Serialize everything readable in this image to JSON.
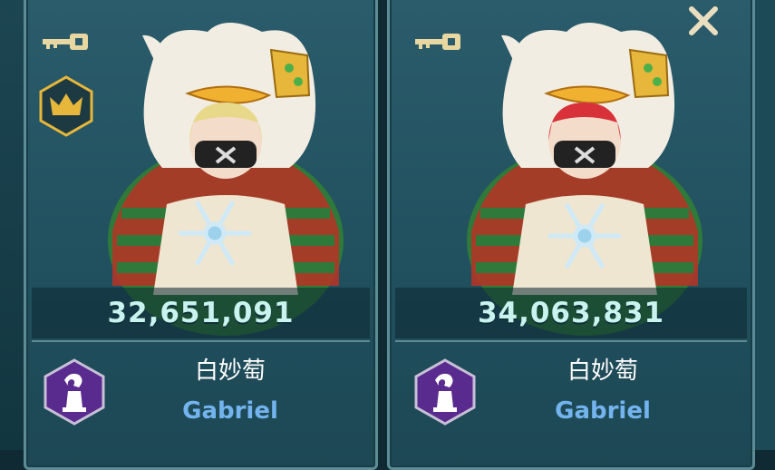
{
  "cards": [
    {
      "score": "32,651,091",
      "name_cn": "白妙萄",
      "name_en": "Gabriel",
      "hair_color": "#e8d98a"
    },
    {
      "score": "34,063,831",
      "name_cn": "白妙萄",
      "name_en": "Gabriel",
      "hair_color": "#d8313a"
    }
  ],
  "icons": {
    "key": "key-icon",
    "crown": "crown-icon",
    "class": "hooded-figure-class-icon",
    "close": "close-icon"
  },
  "colors": {
    "score_text": "#c9f3ee",
    "name_en": "#73b4ef",
    "card_bg": "#2b5c6b",
    "badge_purple": "#5a2b8e",
    "crown_gold": "#e6b73a"
  }
}
